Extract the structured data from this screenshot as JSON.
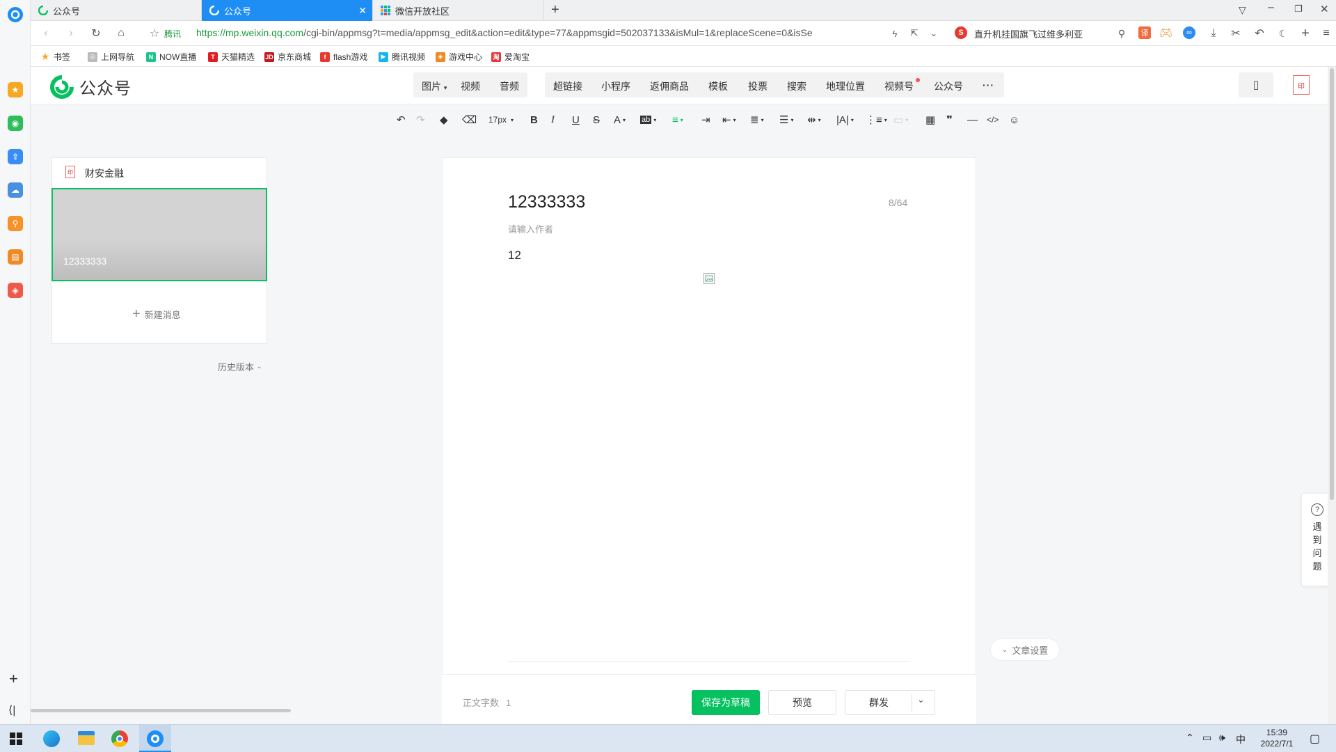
{
  "browser": {
    "tabs": [
      {
        "label": "公众号"
      },
      {
        "label": "公众号"
      },
      {
        "label": "微信开放社区"
      }
    ],
    "url_host": "https://mp.weixin.qq.com",
    "url_path": "/cgi-bin/appmsg?t=media/appmsg_edit&action=edit&type=77&appmsgid=502037133&isMul=1&replaceScene=0&isSe",
    "site_label": "腾讯",
    "search_text": "直升机挂国旗飞过维多利亚"
  },
  "bookmarks": [
    {
      "label": "书签"
    },
    {
      "label": "上网导航"
    },
    {
      "label": "NOW直播"
    },
    {
      "label": "天猫精选"
    },
    {
      "label": "京东商城"
    },
    {
      "label": "flash游戏"
    },
    {
      "label": "腾讯视频"
    },
    {
      "label": "游戏中心"
    },
    {
      "label": "爱淘宝"
    }
  ],
  "header": {
    "logo_text": "公众号",
    "media_items": [
      {
        "label": "图片"
      },
      {
        "label": "视频"
      },
      {
        "label": "音频"
      }
    ],
    "insert_items": [
      {
        "label": "超链接"
      },
      {
        "label": "小程序"
      },
      {
        "label": "返佣商品"
      },
      {
        "label": "模板"
      },
      {
        "label": "投票"
      },
      {
        "label": "搜索"
      },
      {
        "label": "地理位置"
      },
      {
        "label": "视频号"
      },
      {
        "label": "公众号"
      },
      {
        "label": "···"
      }
    ]
  },
  "toolbar": {
    "font_size": "17px"
  },
  "sidebar": {
    "account_name": "财安金融",
    "article_title": "12333333",
    "new_message": "新建消息",
    "history": "历史版本"
  },
  "editor": {
    "title": "12333333",
    "title_count": "8/64",
    "author_placeholder": "请输入作者",
    "body_text": "12",
    "settings": "文章设置"
  },
  "footer": {
    "word_count_label": "正文字数",
    "word_count": "1",
    "save_draft": "保存为草稿",
    "preview": "预览",
    "publish": "群发"
  },
  "help": {
    "label": "遇到问题"
  },
  "taskbar": {
    "ime": "中",
    "time": "15:39",
    "date": "2022/7/1"
  },
  "colors": {
    "accent_green": "#07c160",
    "browser_blue": "#1e8ef4"
  }
}
